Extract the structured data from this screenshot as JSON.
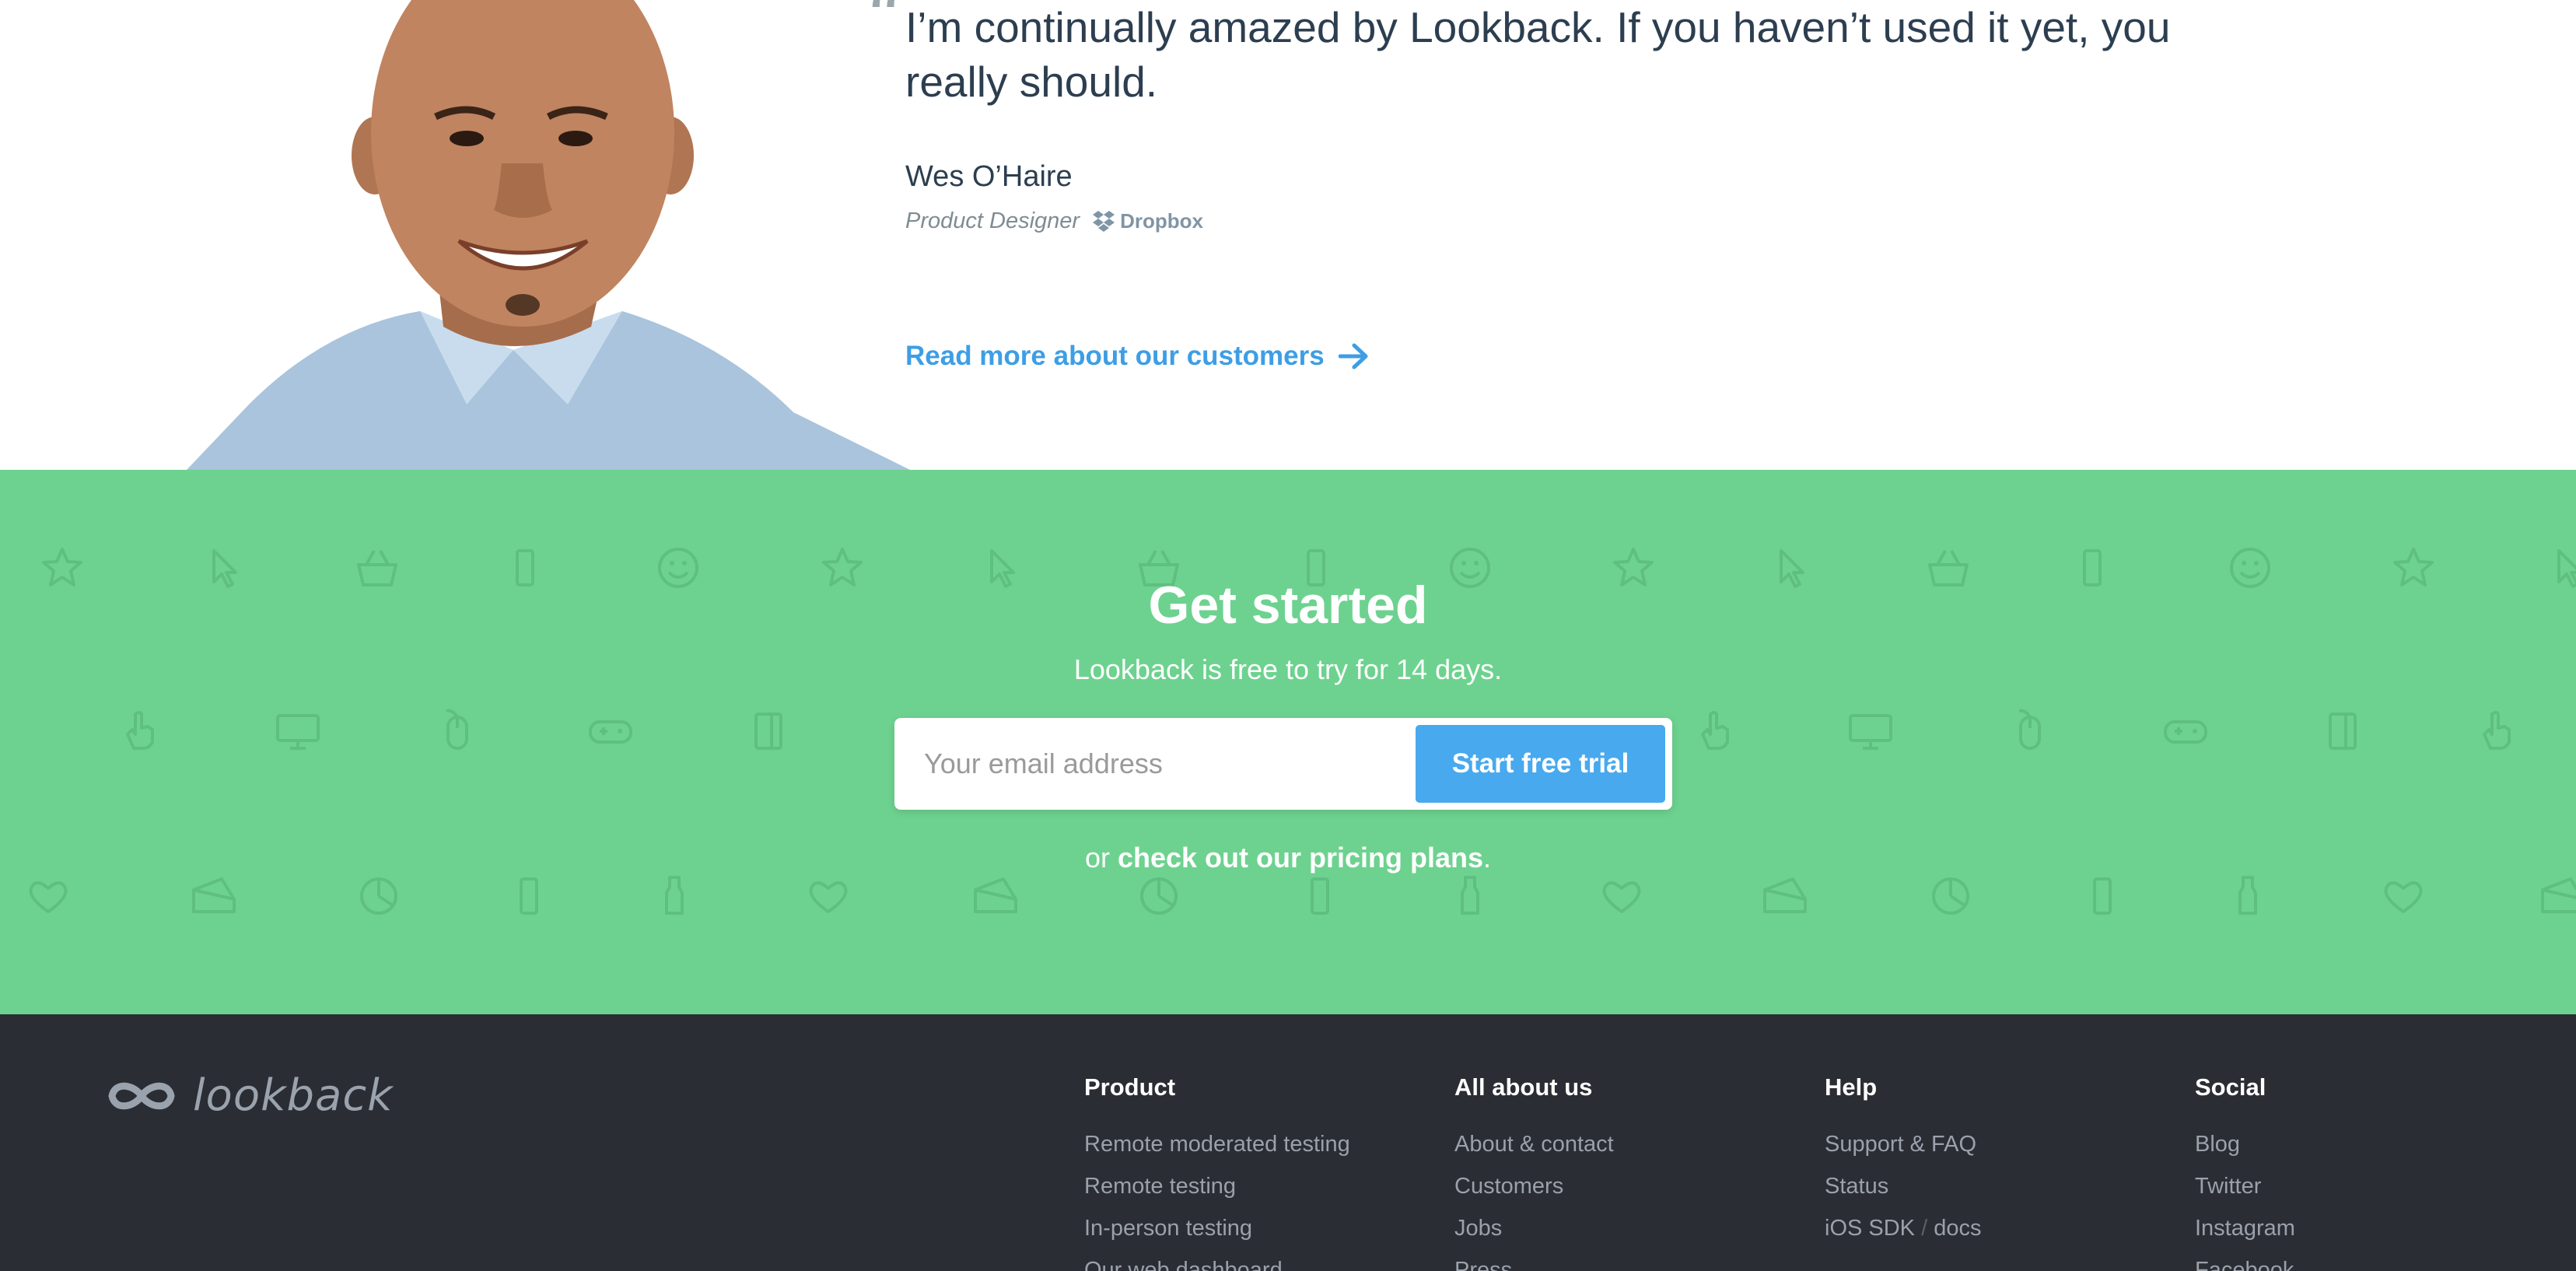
{
  "testimonial": {
    "quote": "I’m continually amazed by Lookback. If you haven’t used it yet, you really should.",
    "author_name": "Wes O’Haire",
    "author_role": "Product Designer",
    "company": "Dropbox",
    "read_more": "Read more about our customers"
  },
  "cta": {
    "title": "Get started",
    "subtitle": "Lookback is free to try for 14 days.",
    "email_placeholder": "Your email address",
    "email_value": "",
    "button_label": "Start free trial",
    "pricing_prefix": "or ",
    "pricing_link": "check out our pricing plans",
    "pricing_suffix": "."
  },
  "footer": {
    "logo_text": "lookback",
    "columns": [
      {
        "title": "Product",
        "links": [
          "Remote moderated testing",
          "Remote testing",
          "In-person testing",
          "Our web dashboard"
        ]
      },
      {
        "title": "All about us",
        "links": [
          "About & contact",
          "Customers",
          "Jobs",
          "Press"
        ]
      },
      {
        "title": "Help",
        "links": [
          "Support & FAQ",
          "Status"
        ],
        "sdk": {
          "left": "iOS SDK",
          "separator": "/",
          "right": "docs"
        }
      },
      {
        "title": "Social",
        "links": [
          "Blog",
          "Twitter",
          "Instagram",
          "Facebook"
        ]
      }
    ]
  },
  "colors": {
    "cta_green": "#6dd28f",
    "link_blue": "#3d9ee5",
    "button_blue": "#48a9ee",
    "footer_bg": "#2a2d33",
    "heading_dark": "#2c3e50"
  },
  "icons": [
    "quote-mark-icon",
    "dropbox-icon",
    "arrow-right-icon",
    "lookback-infinity-icon",
    "background-pattern-icons"
  ]
}
